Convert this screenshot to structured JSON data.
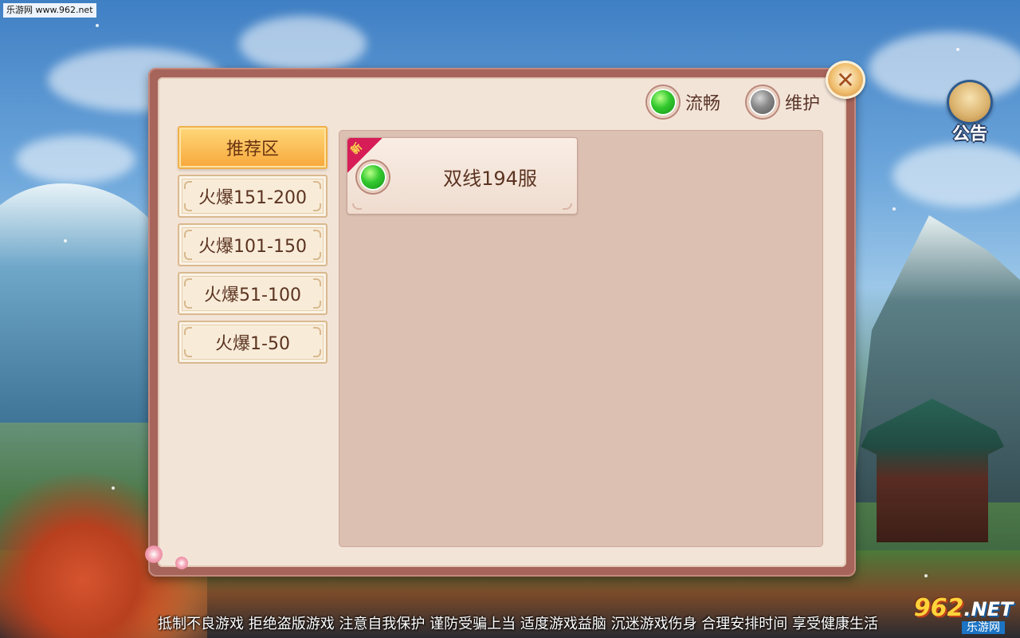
{
  "watermark": {
    "text": "乐游网 www.962.net"
  },
  "dialog": {
    "legend": {
      "smooth_label": "流畅",
      "maintenance_label": "维护"
    },
    "zones": [
      {
        "label": "推荐区",
        "active": true
      },
      {
        "label": "火爆151-200",
        "active": false
      },
      {
        "label": "火爆101-150",
        "active": false
      },
      {
        "label": "火爆51-100",
        "active": false
      },
      {
        "label": "火爆1-50",
        "active": false
      }
    ],
    "servers": [
      {
        "name": "双线194服",
        "status": "smooth",
        "badge": "新"
      }
    ]
  },
  "notice_button": {
    "label": "公告"
  },
  "health_notice": {
    "text": "抵制不良游戏 拒绝盗版游戏 注意自我保护 谨防受骗上当 适度游戏益脑 沉迷游戏伤身 合理安排时间 享受健康生活"
  },
  "logo": {
    "main": "962",
    "main_suffix": ".NET",
    "sub": "乐游网"
  },
  "colors": {
    "status_smooth": "#33c92e",
    "status_maintenance": "#8a8a8a",
    "active_zone": "#f7a83a",
    "new_badge": "#d61d57"
  },
  "icons": {
    "close": "close-icon",
    "notice": "scroll-icon"
  }
}
